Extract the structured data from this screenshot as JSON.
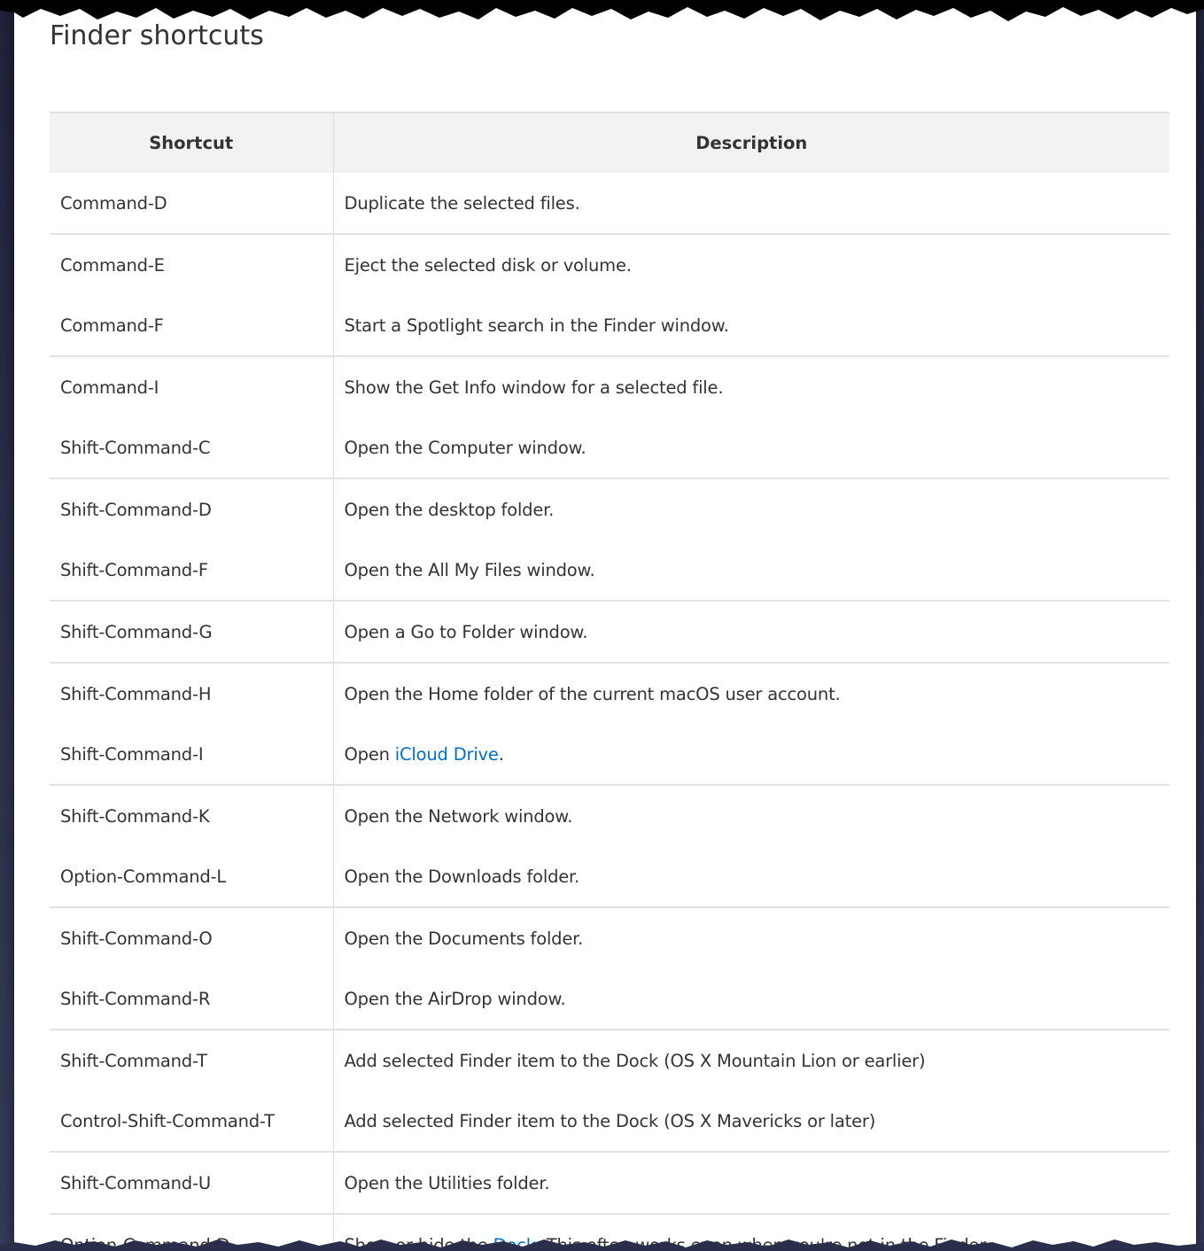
{
  "page_title": "Finder shortcuts",
  "table": {
    "headers": {
      "shortcut": "Shortcut",
      "description": "Description"
    },
    "rows": [
      {
        "shortcut": "Command-D",
        "description": "Duplicate the selected files.",
        "sep": true
      },
      {
        "shortcut": "Command-E",
        "description": "Eject the selected disk or volume.",
        "sep": false
      },
      {
        "shortcut": "Command-F",
        "description": "Start a Spotlight search in the Finder window.",
        "sep": true
      },
      {
        "shortcut": "Command-I",
        "description": "Show the Get Info window for a selected file.",
        "sep": false
      },
      {
        "shortcut": "Shift-Command-C",
        "description": "Open the Computer window.",
        "sep": true
      },
      {
        "shortcut": "Shift-Command-D",
        "description": "Open the desktop folder.",
        "sep": false
      },
      {
        "shortcut": "Shift-Command-F",
        "description": "Open the All My Files window.",
        "sep": true
      },
      {
        "shortcut": "Shift-Command-G",
        "description": "Open a Go to Folder window.",
        "sep": true
      },
      {
        "shortcut": "Shift-Command-H",
        "description": "Open the Home folder of the current macOS user account.",
        "sep": false
      },
      {
        "shortcut": "Shift-Command-I",
        "description_prefix": "Open ",
        "link_text": "iCloud Drive",
        "description_suffix": ".",
        "sep": true
      },
      {
        "shortcut": "Shift-Command-K",
        "description": "Open the Network window.",
        "sep": false
      },
      {
        "shortcut": "Option-Command-L",
        "description": "Open the Downloads folder.",
        "sep": true
      },
      {
        "shortcut": "Shift-Command-O",
        "description": "Open the Documents folder.",
        "sep": false
      },
      {
        "shortcut": "Shift-Command-R",
        "description": "Open the AirDrop window.",
        "sep": true
      },
      {
        "shortcut": "Shift-Command-T",
        "description": "Add selected Finder item to the Dock (OS X Mountain Lion or earlier)",
        "sep": false
      },
      {
        "shortcut": "Control-Shift-Command-T",
        "description": "Add selected Finder item to the Dock (OS X Mavericks or later)",
        "sep": true
      },
      {
        "shortcut": "Shift-Command-U",
        "description": "Open the Utilities folder.",
        "sep": true
      },
      {
        "shortcut": "Option-Command-D",
        "description_prefix": "Show or hide the ",
        "link_text": "Dock",
        "description_suffix": ". This often works even when you're not in the Finder.",
        "sep": false
      }
    ]
  },
  "colors": {
    "link": "#0070c9",
    "text": "#333333",
    "header_bg": "#f2f2f2",
    "background": "#2a2e4a"
  }
}
